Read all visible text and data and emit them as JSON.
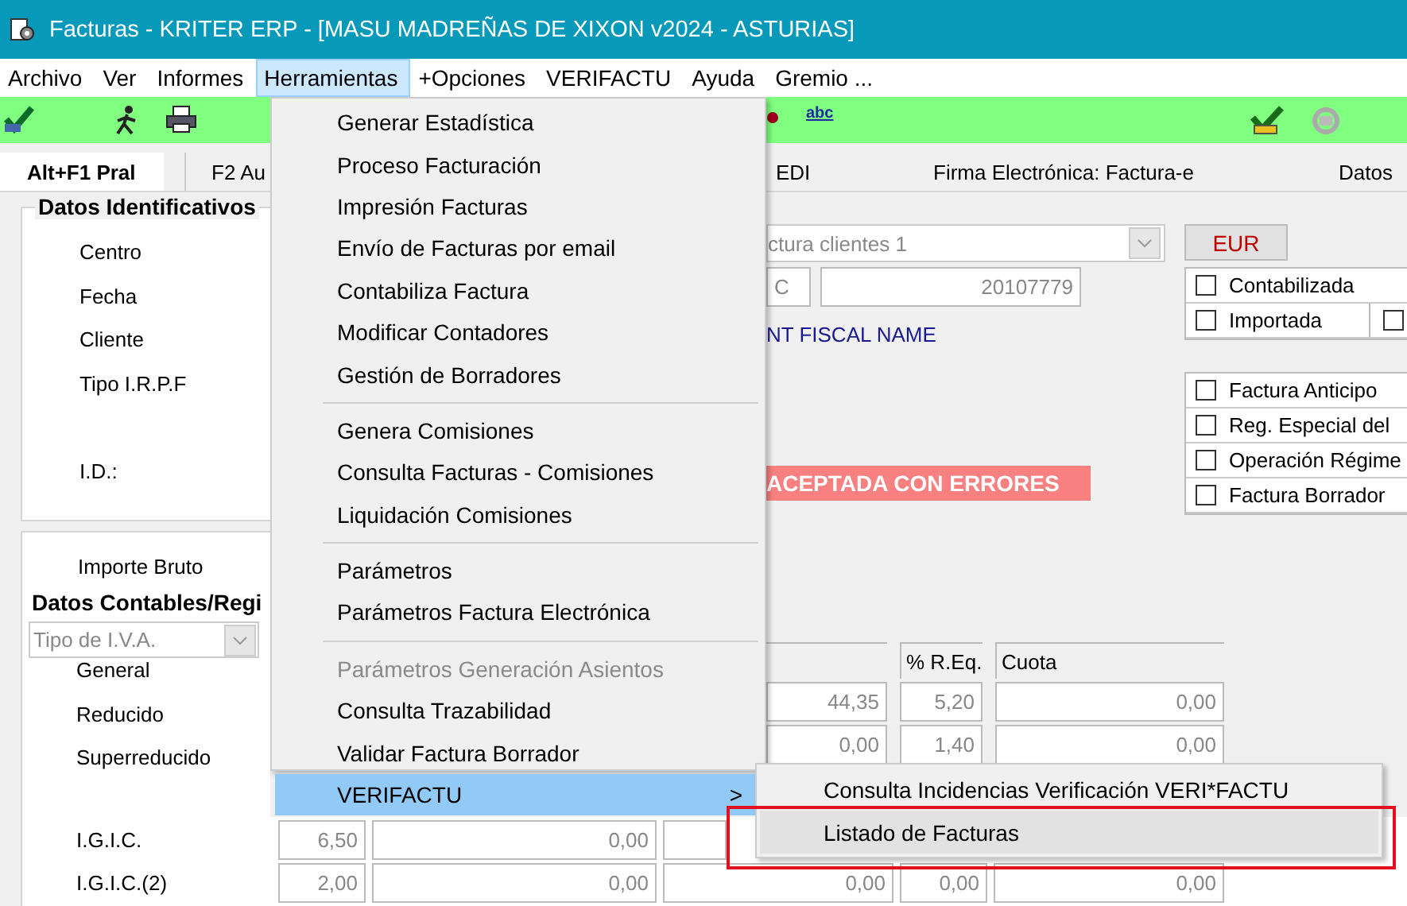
{
  "window": {
    "title": "Facturas - KRITER ERP - [MASU MADREÑAS DE XIXON v2024 - ASTURIAS]"
  },
  "menubar": [
    {
      "label": "Archivo",
      "selected": false
    },
    {
      "label": "Ver",
      "selected": false
    },
    {
      "label": "Informes",
      "selected": false
    },
    {
      "label": "Herramientas",
      "selected": true
    },
    {
      "label": "+Opciones",
      "selected": false
    },
    {
      "label": "VERIFACTU",
      "selected": false
    },
    {
      "label": "Ayuda",
      "selected": false
    },
    {
      "label": "Gremio ...",
      "selected": false
    }
  ],
  "toolbar": {
    "spell_label": "abc"
  },
  "tabs": [
    {
      "label": "Alt+F1 Pral",
      "selected": true
    },
    {
      "label": "F2 Au",
      "selected": false
    },
    {
      "label": "EDI",
      "selected": false
    },
    {
      "label": "Firma Electrónica: Factura-e",
      "selected": false
    },
    {
      "label": "Datos",
      "selected": false
    }
  ],
  "identification": {
    "title": "Datos Identificativos",
    "labels": [
      "Centro",
      "Fecha",
      "Cliente",
      "Tipo I.R.P.F",
      "I.D.:"
    ],
    "series_combo": "ctura clientes 1",
    "series_code": "C",
    "number": "20107779",
    "client_name": "NT FISCAL NAME",
    "status": "ACEPTADA CON ERRORES",
    "currency": "EUR",
    "top_checks": [
      {
        "label": "Contabilizada",
        "checked": false
      },
      {
        "label": "Importada",
        "checked": false
      },
      {
        "checked": false
      }
    ],
    "checks": [
      {
        "label": "Factura Anticipo",
        "checked": false
      },
      {
        "label": "Reg. Especial del",
        "checked": false
      },
      {
        "label": "Operación Régime",
        "checked": false
      },
      {
        "label": "Factura Borrador",
        "checked": false
      }
    ]
  },
  "accounting": {
    "amount_label": "Importe Bruto",
    "title": "Datos Contables/Regi",
    "vat_combo": "Tipo de I.V.A.",
    "headers": [
      "% R.Eq.",
      "Cuota"
    ],
    "rows": [
      {
        "label": "General",
        "base": "44,35",
        "req": "5,20",
        "cuota": "0,00"
      },
      {
        "label": "Reducido",
        "base": "0,00",
        "req": "1,40",
        "cuota": "0,00"
      },
      {
        "label": "Superreducido"
      }
    ],
    "igic_rows": [
      {
        "label": "I.G.I.C.",
        "rate": "6,50",
        "base": "0,00",
        "fields": []
      },
      {
        "label": "I.G.I.C.(2)",
        "rate": "2,00",
        "base": "0,00",
        "fields": [
          "0,00",
          "0,00",
          "0,00"
        ]
      }
    ]
  },
  "menu": [
    {
      "kind": "item",
      "label": "Generar Estadística",
      "disabled": false,
      "selected": false
    },
    {
      "kind": "item",
      "label": "Proceso Facturación",
      "disabled": false,
      "selected": false
    },
    {
      "kind": "item",
      "label": "Impresión Facturas",
      "disabled": false,
      "selected": false
    },
    {
      "kind": "item",
      "label": "Envío de Facturas por email",
      "disabled": false,
      "selected": false
    },
    {
      "kind": "item",
      "label": "Contabiliza Factura",
      "disabled": false,
      "selected": false
    },
    {
      "kind": "item",
      "label": "Modificar Contadores",
      "disabled": false,
      "selected": false
    },
    {
      "kind": "item",
      "label": "Gestión de Borradores",
      "disabled": false,
      "selected": false
    },
    {
      "kind": "separator"
    },
    {
      "kind": "item",
      "label": "Genera Comisiones",
      "disabled": false,
      "selected": false
    },
    {
      "kind": "item",
      "label": "Consulta Facturas - Comisiones",
      "disabled": false,
      "selected": false
    },
    {
      "kind": "item",
      "label": "Liquidación Comisiones",
      "disabled": false,
      "selected": false
    },
    {
      "kind": "separator"
    },
    {
      "kind": "item",
      "label": "Parámetros",
      "disabled": false,
      "selected": false
    },
    {
      "kind": "item",
      "label": "Parámetros Factura Electrónica",
      "disabled": false,
      "selected": false
    },
    {
      "kind": "separator"
    },
    {
      "kind": "item",
      "label": "Parámetros Generación Asientos",
      "disabled": true,
      "selected": false
    },
    {
      "kind": "item",
      "label": "Consulta Trazabilidad",
      "disabled": false,
      "selected": false
    },
    {
      "kind": "item",
      "label": "Validar Factura Borrador",
      "disabled": false,
      "selected": false
    },
    {
      "kind": "submenu",
      "label": "VERIFACTU",
      "arrow": ">",
      "disabled": false,
      "selected": true
    }
  ],
  "submenu": [
    {
      "label": "Consulta Incidencias Verificación VERI*FACTU",
      "highlighted": false
    },
    {
      "label": "Listado de Facturas",
      "highlighted": true
    }
  ]
}
